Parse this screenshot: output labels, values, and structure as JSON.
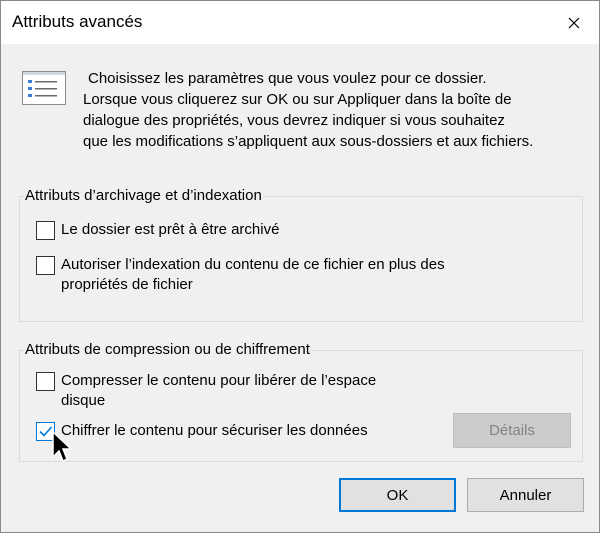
{
  "window": {
    "title": "Attributs avancés",
    "close_icon": "close-icon"
  },
  "description": {
    "line1": "Choisissez les paramètres que vous voulez pour ce dossier.",
    "line2": "Lorsque vous cliquerez sur OK ou sur Appliquer dans la boîte de",
    "line3": "dialogue des propriétés, vous devrez indiquer si vous souhaitez",
    "line4": "que les modifications s’appliquent aux sous-dossiers et aux fichiers."
  },
  "archive_group": {
    "legend": "Attributs d’archivage et d’indexation",
    "archive": {
      "label": "Le dossier est prêt à être archivé",
      "checked": false
    },
    "index": {
      "label_line1": "Autoriser l’indexation du contenu de ce fichier en plus des",
      "label_line2": "propriétés de fichier",
      "checked": false
    }
  },
  "compress_group": {
    "legend": "Attributs de compression ou de chiffrement",
    "compress": {
      "label_line1": "Compresser le contenu pour libérer de l’espace",
      "label_line2": "disque",
      "checked": false
    },
    "encrypt": {
      "label": "Chiffrer le contenu pour sécuriser les données",
      "checked": true
    },
    "details_label": "Détails"
  },
  "buttons": {
    "ok": "OK",
    "cancel": "Annuler"
  },
  "colors": {
    "accent": "#0078d7",
    "dialog_bg": "#f0f0f0",
    "disabled_text": "#838383"
  }
}
